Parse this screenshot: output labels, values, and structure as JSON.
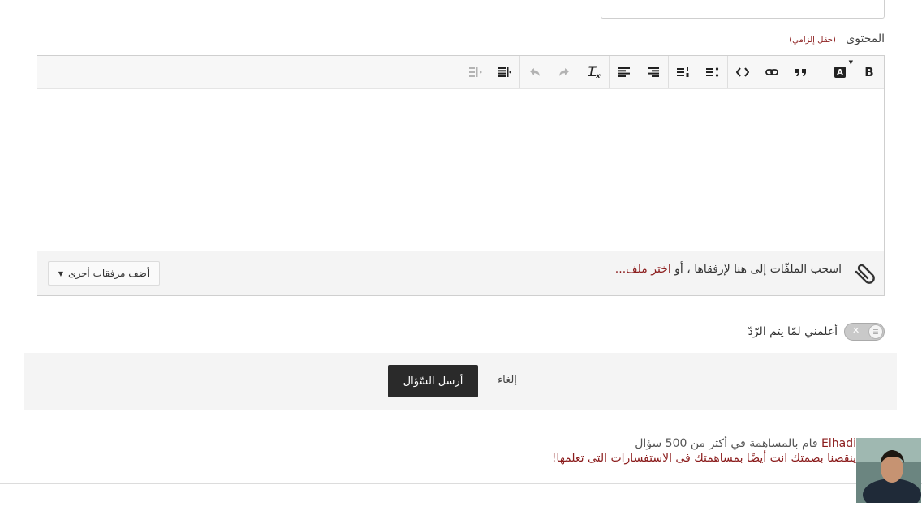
{
  "form": {
    "content_label": "المحتوى",
    "required_hint": "(حقل إلزامي)"
  },
  "toolbar": {
    "buttons": [
      {
        "name": "bold",
        "label": "B"
      },
      {
        "name": "text-color",
        "label": "A"
      },
      {
        "name": "blockquote",
        "label": "”"
      },
      {
        "name": "link",
        "label": ""
      },
      {
        "name": "code",
        "label": "<>"
      },
      {
        "name": "bulleted-list",
        "label": ""
      },
      {
        "name": "numbered-list",
        "label": ""
      },
      {
        "name": "align-right",
        "label": ""
      },
      {
        "name": "align-left",
        "label": ""
      },
      {
        "name": "remove-format",
        "label": "Tx"
      },
      {
        "name": "redo",
        "label": ""
      },
      {
        "name": "undo",
        "label": ""
      },
      {
        "name": "rtl-direction",
        "label": ""
      },
      {
        "name": "ltr-direction",
        "label": ""
      }
    ]
  },
  "attachments": {
    "drop_text": "اسحب الملفّات إلى هنا لإرفقاها ، أو",
    "choose_file": "اختر ملف...",
    "more_button": "أضف مرفقات أخرى"
  },
  "notify": {
    "label": "أعلمني لمّا يتم الرّدّ"
  },
  "actions": {
    "submit": "أرسل السّؤال",
    "cancel": "إلغاء"
  },
  "contribution": {
    "user": "Elhadi",
    "line1_rest": "قام بالمساهمة في أكثر من 500 سؤال",
    "line2": "ينقصنا بصمتك انت أيضًا بمساهمتك فى الاستفسارات التى تعلمها!"
  },
  "colors": {
    "accent": "#8b1c1c",
    "primary_button": "#2a2a2a",
    "panel_bg": "#f4f4f4"
  }
}
